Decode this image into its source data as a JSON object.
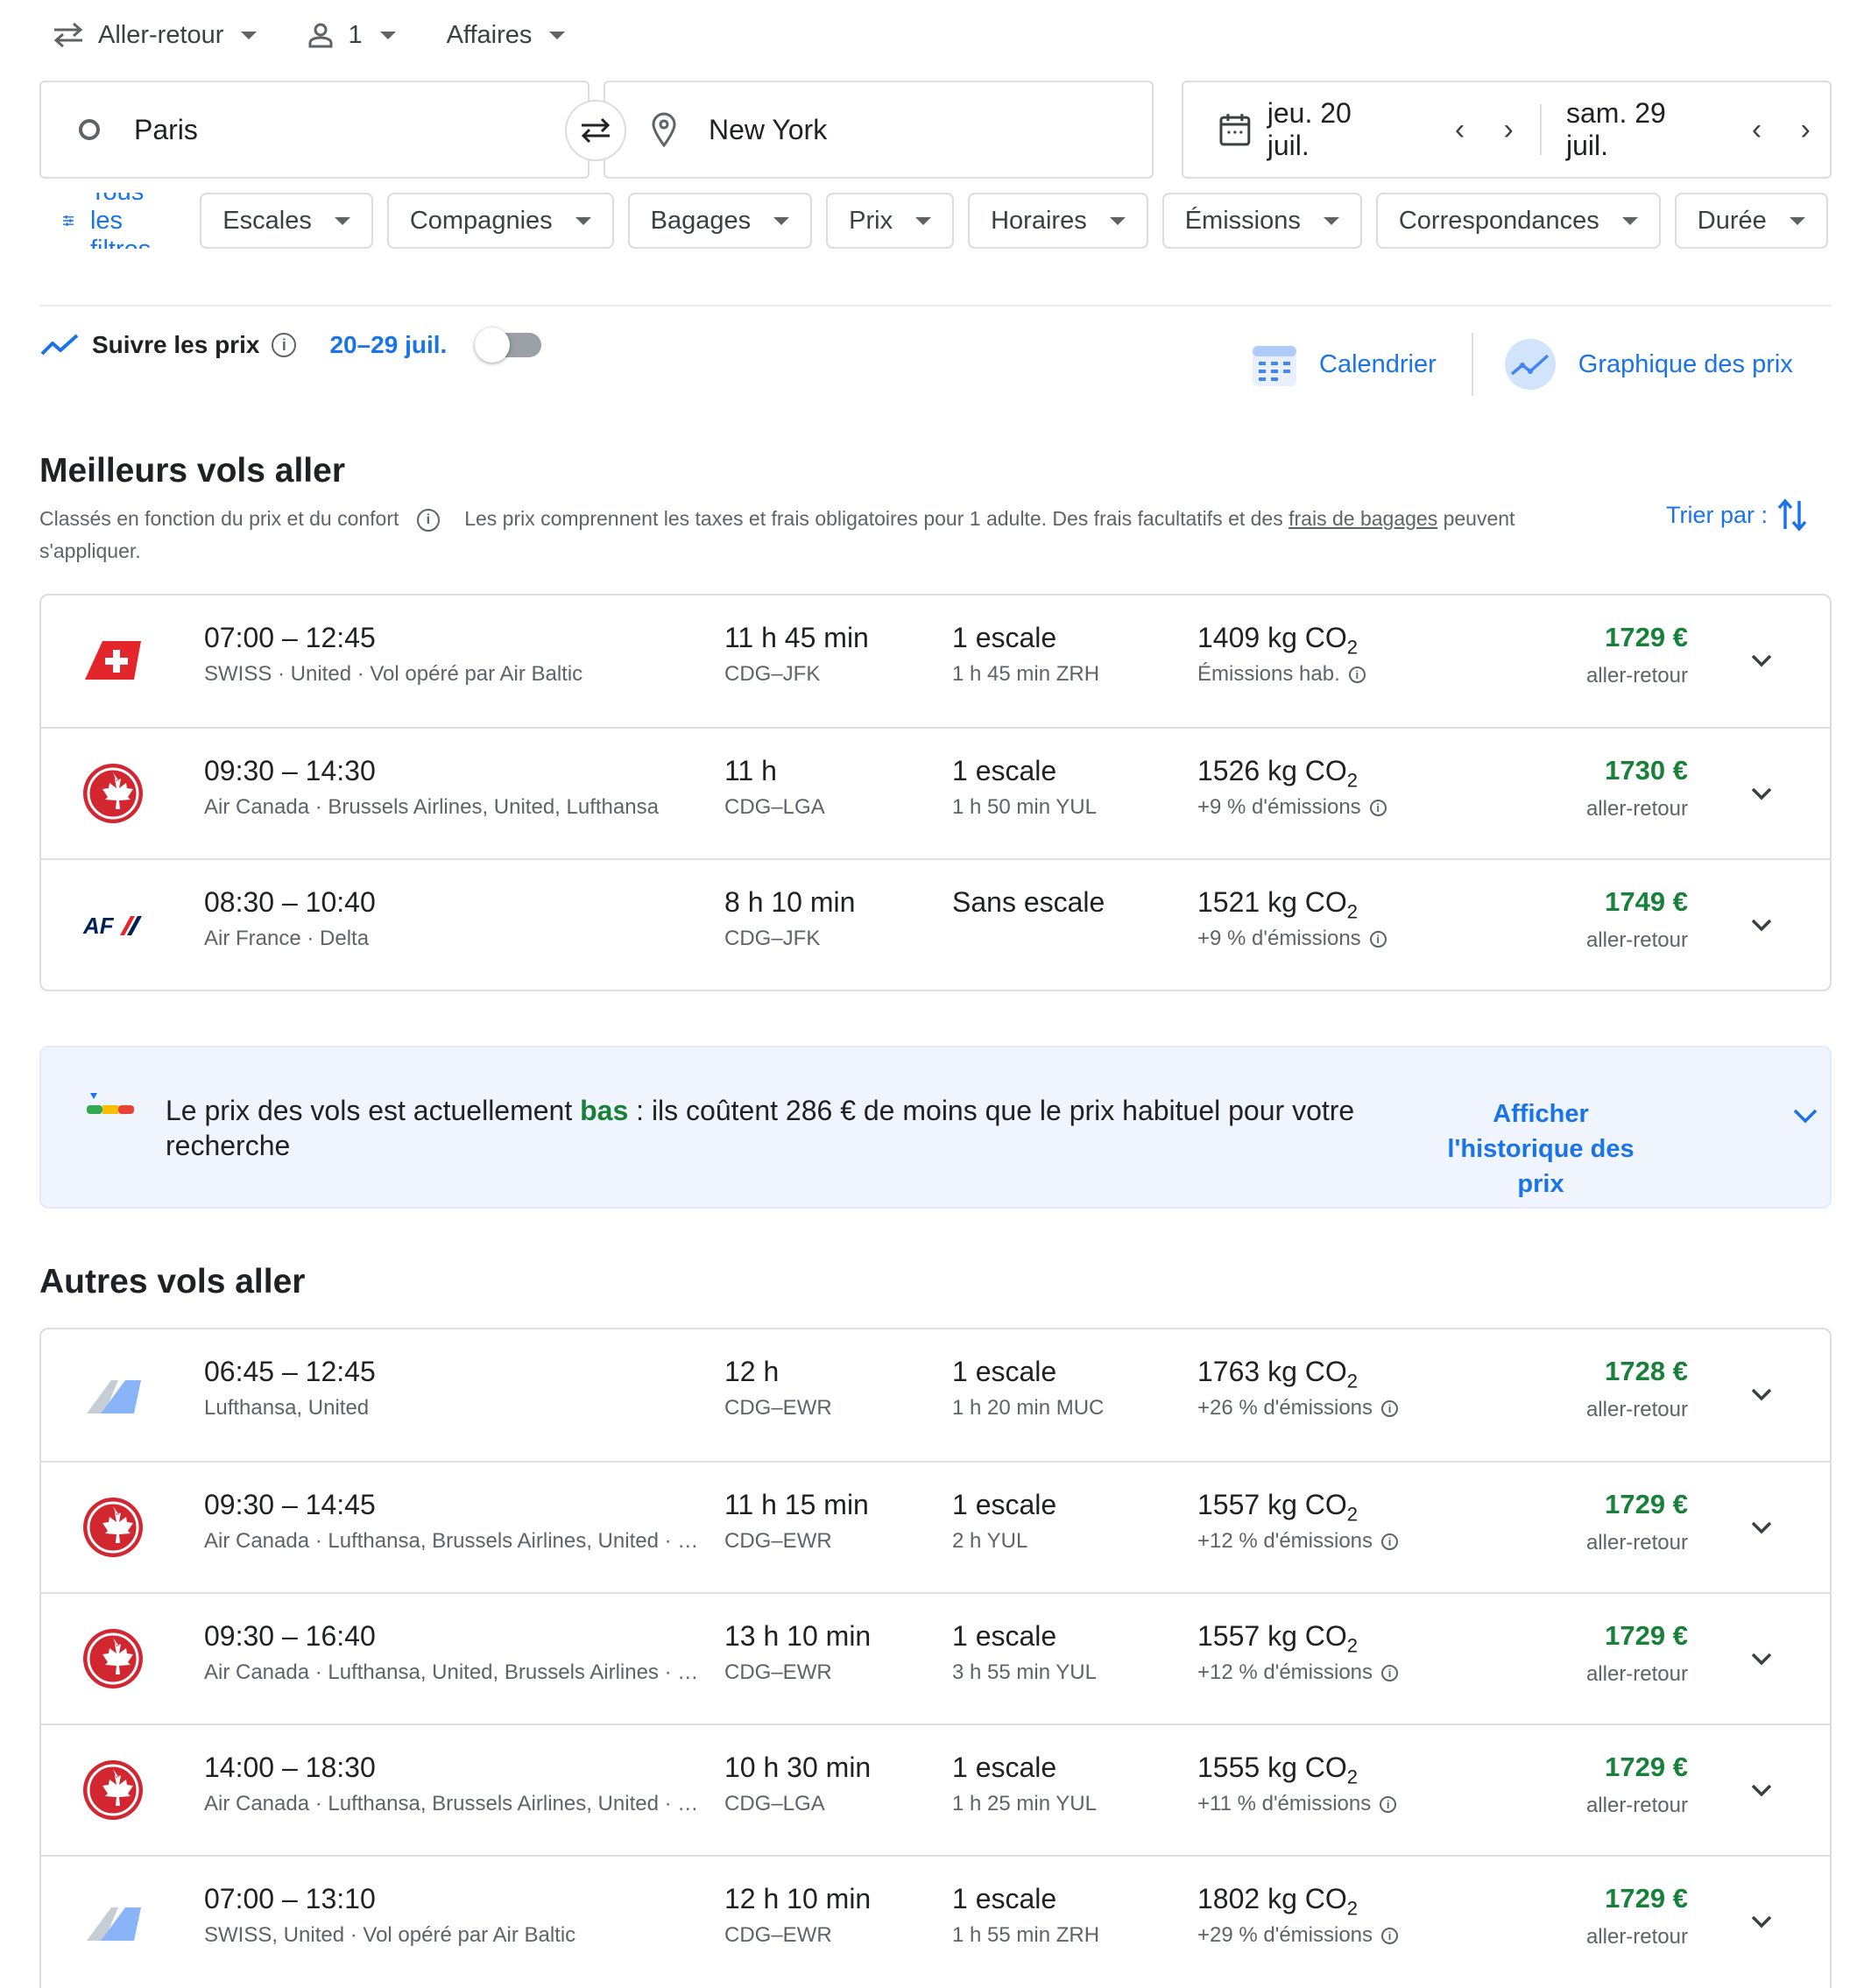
{
  "trip": {
    "trip_type": "Aller-retour",
    "passengers": "1",
    "cabin": "Affaires"
  },
  "search": {
    "origin": "Paris",
    "destination": "New York",
    "depart_date": "jeu. 20 juil.",
    "return_date": "sam. 29 juil."
  },
  "filters": {
    "all_label": "Tous les filtres",
    "chips": [
      "Escales",
      "Compagnies",
      "Bagages",
      "Prix",
      "Horaires",
      "Émissions",
      "Correspondances",
      "Durée"
    ]
  },
  "tracking": {
    "label": "Suivre les prix",
    "range": "20–29 juil.",
    "enabled": false
  },
  "views": {
    "calendar": "Calendrier",
    "price_graph": "Graphique des prix"
  },
  "best": {
    "title": "Meilleurs vols aller",
    "ranked": "Classés en fonction du prix et du confort",
    "note_pre": "Les prix comprennent les taxes et frais obligatoires pour 1 adulte. Des frais facultatifs et des ",
    "note_link": "frais de bagages",
    "note_post": " peuvent s'appliquer.",
    "sort_label": "Trier par :",
    "flights": [
      {
        "logo": "swiss",
        "times": "07:00 – 12:45",
        "airlines": "SWISS · United · Vol opéré par Air Baltic",
        "duration": "11 h 45 min",
        "route": "CDG–JFK",
        "stops": "1 escale",
        "stop_detail": "1 h 45 min ZRH",
        "co2": "1409 kg CO",
        "emissions": "Émissions hab.",
        "price": "1729 €",
        "price_type": "aller-retour"
      },
      {
        "logo": "aircanada",
        "times": "09:30 – 14:30",
        "airlines": "Air Canada · Brussels Airlines, United, Lufthansa",
        "duration": "11 h",
        "route": "CDG–LGA",
        "stops": "1 escale",
        "stop_detail": "1 h 50 min YUL",
        "co2": "1526 kg CO",
        "emissions": "+9 % d'émissions",
        "price": "1730 €",
        "price_type": "aller-retour"
      },
      {
        "logo": "airfrance",
        "times": "08:30 – 10:40",
        "airlines": "Air France · Delta",
        "duration": "8 h 10 min",
        "route": "CDG–JFK",
        "stops": "Sans escale",
        "stop_detail": "",
        "co2": "1521 kg CO",
        "emissions": "+9 % d'émissions",
        "price": "1749 €",
        "price_type": "aller-retour"
      }
    ]
  },
  "insight": {
    "pre": "Le prix des vols est actuellement ",
    "level": "bas",
    "post": " : ils coûtent 286 € de moins que le prix habituel pour votre recherche",
    "history": "Afficher l'historique des prix"
  },
  "other": {
    "title": "Autres vols aller",
    "flights": [
      {
        "logo": "multi",
        "times": "06:45 – 12:45",
        "airlines": "Lufthansa, United",
        "duration": "12 h",
        "route": "CDG–EWR",
        "stops": "1 escale",
        "stop_detail": "1 h 20 min MUC",
        "co2": "1763 kg CO",
        "emissions": "+26 % d'émissions",
        "price": "1728 €",
        "price_type": "aller-retour"
      },
      {
        "logo": "aircanada",
        "times": "09:30 – 14:45",
        "airlines": "Air Canada · Lufthansa, Brussels Airlines, United · …",
        "duration": "11 h 15 min",
        "route": "CDG–EWR",
        "stops": "1 escale",
        "stop_detail": "2 h YUL",
        "co2": "1557 kg CO",
        "emissions": "+12 % d'émissions",
        "price": "1729 €",
        "price_type": "aller-retour"
      },
      {
        "logo": "aircanada",
        "times": "09:30 – 16:40",
        "airlines": "Air Canada · Lufthansa, United, Brussels Airlines · …",
        "duration": "13 h 10 min",
        "route": "CDG–EWR",
        "stops": "1 escale",
        "stop_detail": "3 h 55 min YUL",
        "co2": "1557 kg CO",
        "emissions": "+12 % d'émissions",
        "price": "1729 €",
        "price_type": "aller-retour"
      },
      {
        "logo": "aircanada",
        "times": "14:00 – 18:30",
        "airlines": "Air Canada · Lufthansa, Brussels Airlines, United · …",
        "duration": "10 h 30 min",
        "route": "CDG–LGA",
        "stops": "1 escale",
        "stop_detail": "1 h 25 min YUL",
        "co2": "1555 kg CO",
        "emissions": "+11 % d'émissions",
        "price": "1729 €",
        "price_type": "aller-retour"
      },
      {
        "logo": "multi",
        "times": "07:00 – 13:10",
        "airlines": "SWISS, United · Vol opéré par Air Baltic",
        "duration": "12 h 10 min",
        "route": "CDG–EWR",
        "stops": "1 escale",
        "stop_detail": "1 h 55 min ZRH",
        "co2": "1802 kg CO",
        "emissions": "+29 % d'émissions",
        "price": "1729 €",
        "price_type": "aller-retour"
      }
    ]
  },
  "colors": {
    "accent": "#1a73e8",
    "price_green": "#188038",
    "aircanada_red": "#d22630",
    "swiss_red": "#e3262b"
  }
}
